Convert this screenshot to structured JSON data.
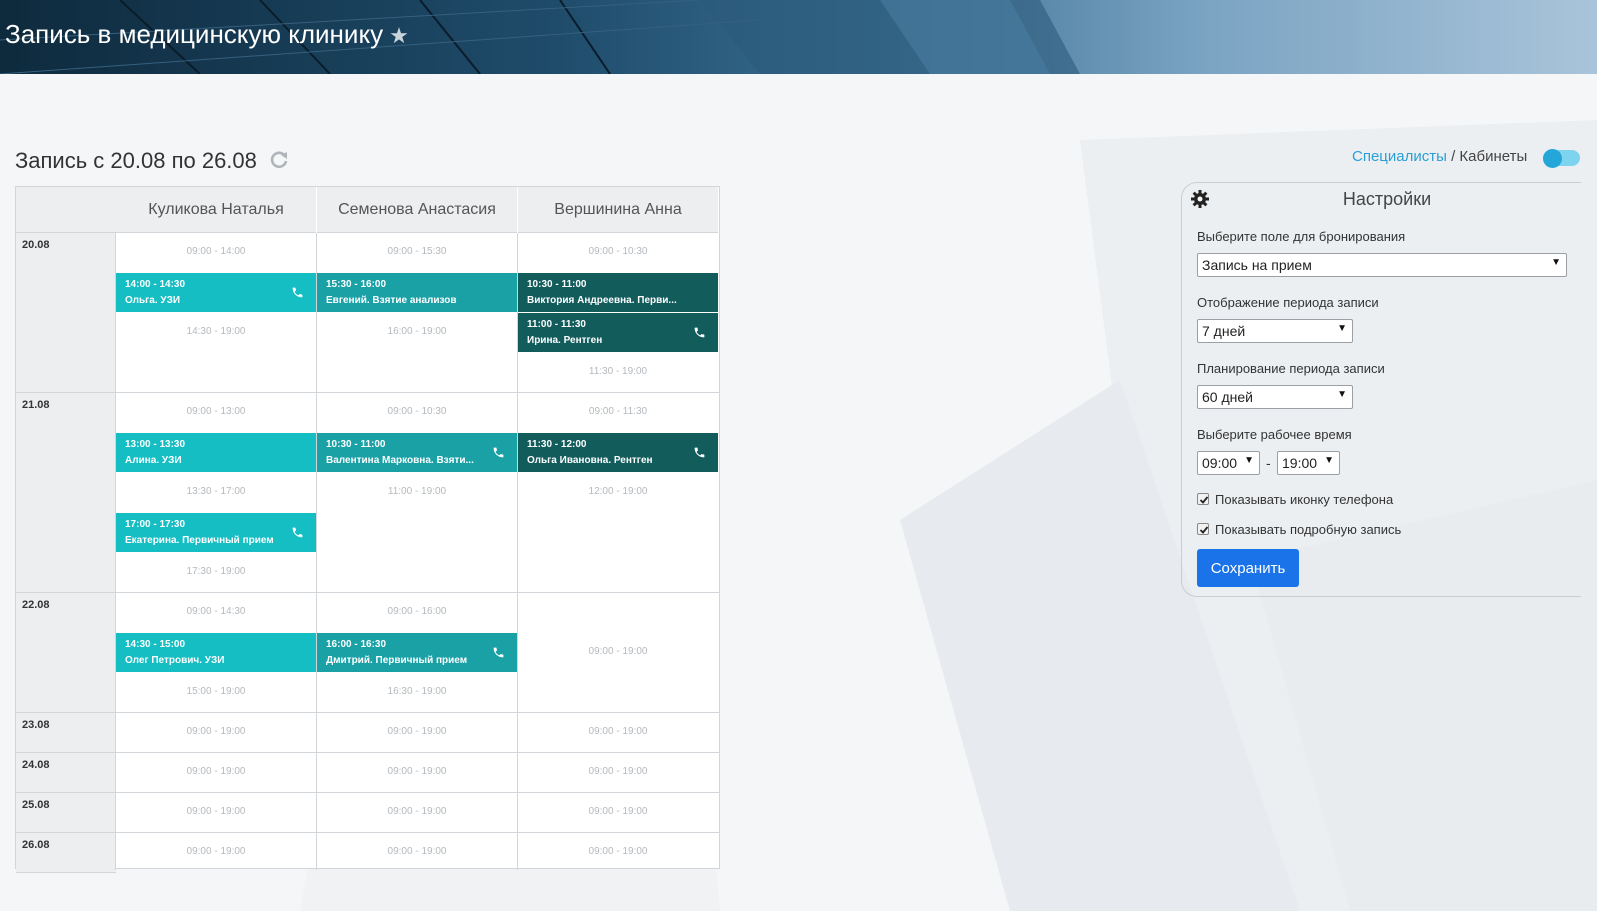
{
  "header": {
    "title": "Запись в медицинскую клинику",
    "star": "★"
  },
  "calendar": {
    "title": "Запись с 20.08 по 26.08",
    "specialists": [
      "Куликова Наталья",
      "Семенова Анастасия",
      "Вершинина Анна"
    ],
    "days": [
      {
        "date": "20.08",
        "cols": [
          [
            {
              "type": "free",
              "text": "09:00 - 14:00"
            },
            {
              "type": "appt",
              "time": "14:00 - 14:30",
              "name": "Ольга. УЗИ",
              "phone": true
            },
            {
              "type": "free",
              "text": "14:30 - 19:00"
            }
          ],
          [
            {
              "type": "free",
              "text": "09:00 - 15:30"
            },
            {
              "type": "appt",
              "time": "15:30 - 16:00",
              "name": "Евгений. Взятие анализов",
              "phone": false
            },
            {
              "type": "free",
              "text": "16:00 - 19:00"
            }
          ],
          [
            {
              "type": "free",
              "text": "09:00 - 10:30"
            },
            {
              "type": "appt",
              "time": "10:30 - 11:00",
              "name": "Виктория Андреевна. Перви...",
              "phone": false
            },
            {
              "type": "appt",
              "time": "11:00 - 11:30",
              "name": "Ирина. Рентген",
              "phone": true
            },
            {
              "type": "free",
              "text": "11:30 - 19:00"
            }
          ]
        ]
      },
      {
        "date": "21.08",
        "cols": [
          [
            {
              "type": "free",
              "text": "09:00 - 13:00"
            },
            {
              "type": "appt",
              "time": "13:00 - 13:30",
              "name": "Алина. УЗИ",
              "phone": false
            },
            {
              "type": "free",
              "text": "13:30 - 17:00"
            },
            {
              "type": "appt",
              "time": "17:00 - 17:30",
              "name": "Екатерина. Первичный прием",
              "phone": true
            },
            {
              "type": "free",
              "text": "17:30 - 19:00"
            }
          ],
          [
            {
              "type": "free",
              "text": "09:00 - 10:30"
            },
            {
              "type": "appt",
              "time": "10:30 - 11:00",
              "name": "Валентина Марковна. Взяти...",
              "phone": true
            },
            {
              "type": "free",
              "text": "11:00 - 19:00"
            }
          ],
          [
            {
              "type": "free",
              "text": "09:00 - 11:30"
            },
            {
              "type": "appt",
              "time": "11:30 - 12:00",
              "name": "Ольга Ивановна. Рентген",
              "phone": true
            },
            {
              "type": "free",
              "text": "12:00 - 19:00"
            }
          ]
        ]
      },
      {
        "date": "22.08",
        "cols": [
          [
            {
              "type": "free",
              "text": "09:00 - 14:30"
            },
            {
              "type": "appt",
              "time": "14:30 - 15:00",
              "name": "Олег Петрович. УЗИ",
              "phone": false
            },
            {
              "type": "free",
              "text": "15:00 - 19:00"
            }
          ],
          [
            {
              "type": "free",
              "text": "09:00 - 16:00"
            },
            {
              "type": "appt",
              "time": "16:00 - 16:30",
              "name": "Дмитрий. Первичный прием",
              "phone": true
            },
            {
              "type": "free",
              "text": "16:30 - 19:00"
            }
          ],
          [
            {
              "type": "free",
              "text": "09:00 - 19:00"
            }
          ]
        ]
      },
      {
        "date": "23.08",
        "cols": [
          [
            {
              "type": "free",
              "text": "09:00 - 19:00"
            }
          ],
          [
            {
              "type": "free",
              "text": "09:00 - 19:00"
            }
          ],
          [
            {
              "type": "free",
              "text": "09:00 - 19:00"
            }
          ]
        ]
      },
      {
        "date": "24.08",
        "cols": [
          [
            {
              "type": "free",
              "text": "09:00 - 19:00"
            }
          ],
          [
            {
              "type": "free",
              "text": "09:00 - 19:00"
            }
          ],
          [
            {
              "type": "free",
              "text": "09:00 - 19:00"
            }
          ]
        ]
      },
      {
        "date": "25.08",
        "cols": [
          [
            {
              "type": "free",
              "text": "09:00 - 19:00"
            }
          ],
          [
            {
              "type": "free",
              "text": "09:00 - 19:00"
            }
          ],
          [
            {
              "type": "free",
              "text": "09:00 - 19:00"
            }
          ]
        ]
      },
      {
        "date": "26.08",
        "cols": [
          [
            {
              "type": "free",
              "text": "09:00 - 19:00"
            }
          ],
          [
            {
              "type": "free",
              "text": "09:00 - 19:00"
            }
          ],
          [
            {
              "type": "free",
              "text": "09:00 - 19:00"
            }
          ]
        ]
      }
    ]
  },
  "view_toggle": {
    "specialists_label": "Специалисты",
    "separator": "/",
    "cabinets_label": "Кабинеты",
    "state": "specialists"
  },
  "settings": {
    "title": "Настройки",
    "booking_field_label": "Выберите поле для бронирования",
    "booking_field_value": "Запись на прием",
    "display_period_label": "Отображение периода записи",
    "display_period_value": "7 дней",
    "planning_period_label": "Планирование периода записи",
    "planning_period_value": "60 дней",
    "work_time_label": "Выберите рабочее время",
    "work_time_from": "09:00",
    "work_time_separator": "-",
    "work_time_to": "19:00",
    "show_phone_icon_label": "Показывать иконку телефона",
    "show_phone_icon": true,
    "show_detailed_label": "Показывать подробную запись",
    "show_detailed": true,
    "save_label": "Сохранить"
  },
  "colors": {
    "appt_light": "#14bec3",
    "appt_mid": "#1aa1a6",
    "appt_dark": "#125c5c",
    "primary": "#1a73e8",
    "link": "#2a9fd6"
  }
}
